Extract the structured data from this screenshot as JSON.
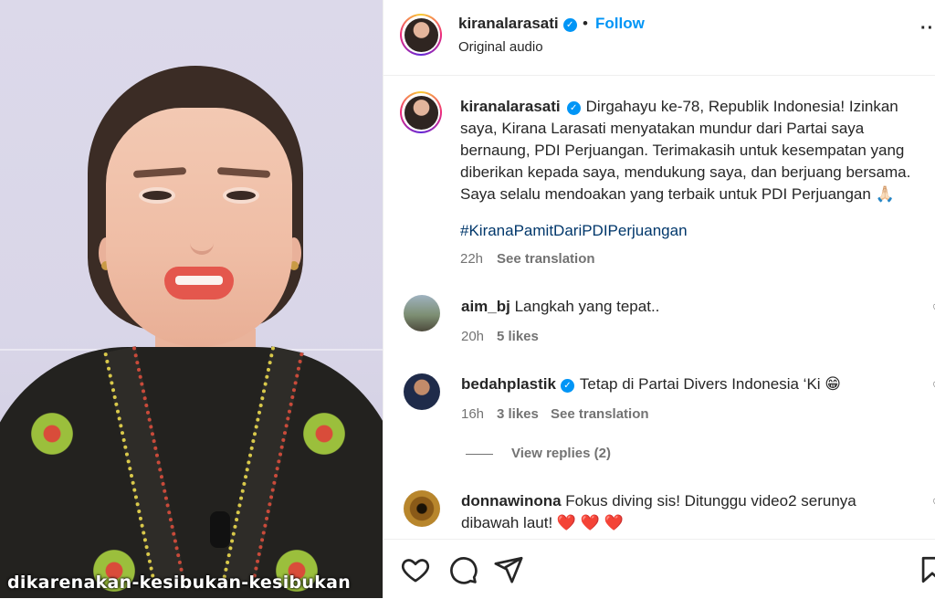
{
  "media": {
    "overlay_caption": "dikarenakan-kesibukan-kesibukan"
  },
  "header": {
    "username": "kiranalarasati",
    "separator": "•",
    "follow_label": "Follow",
    "audio": "Original audio",
    "more": "··"
  },
  "post": {
    "username": "kiranalarasati",
    "line1": "Dirgahayu ke-78, Republik Indonesia!",
    "body": "Izinkan saya, Kirana Larasati menyatakan mundur dari Partai saya bernaung, PDI Perjuangan. Terimakasih untuk kesempatan yang diberikan kepada saya, mendukung saya, dan berjuang bersama. Saya selalu mendoakan yang terbaik untuk PDI Perjuangan",
    "emoji": "🙏🏻",
    "hashtag": "#KiranaPamitDariPDIPerjuangan",
    "time": "22h",
    "see_translation": "See translation"
  },
  "comments": [
    {
      "username": "aim_bj",
      "verified": false,
      "text": "Langkah yang tepat..",
      "time": "20h",
      "likes": "5 likes",
      "see_translation": ""
    },
    {
      "username": "bedahplastik",
      "verified": true,
      "text": "Tetap di Partai Divers Indonesia ‘Ki 😁",
      "time": "16h",
      "likes": "3 likes",
      "see_translation": "See translation",
      "view_replies": "View replies (2)"
    },
    {
      "username": "donnawinona",
      "verified": false,
      "text": "Fokus diving sis! Ditunggu video2 serunya dibawah laut! ❤️ ❤️ ❤️"
    }
  ],
  "icons": {
    "like": "heart-icon",
    "comment": "comment-icon",
    "share": "share-icon",
    "save": "bookmark-icon"
  },
  "colors": {
    "accent": "#0095f6",
    "hashtag": "#00376b",
    "muted": "#737373"
  }
}
